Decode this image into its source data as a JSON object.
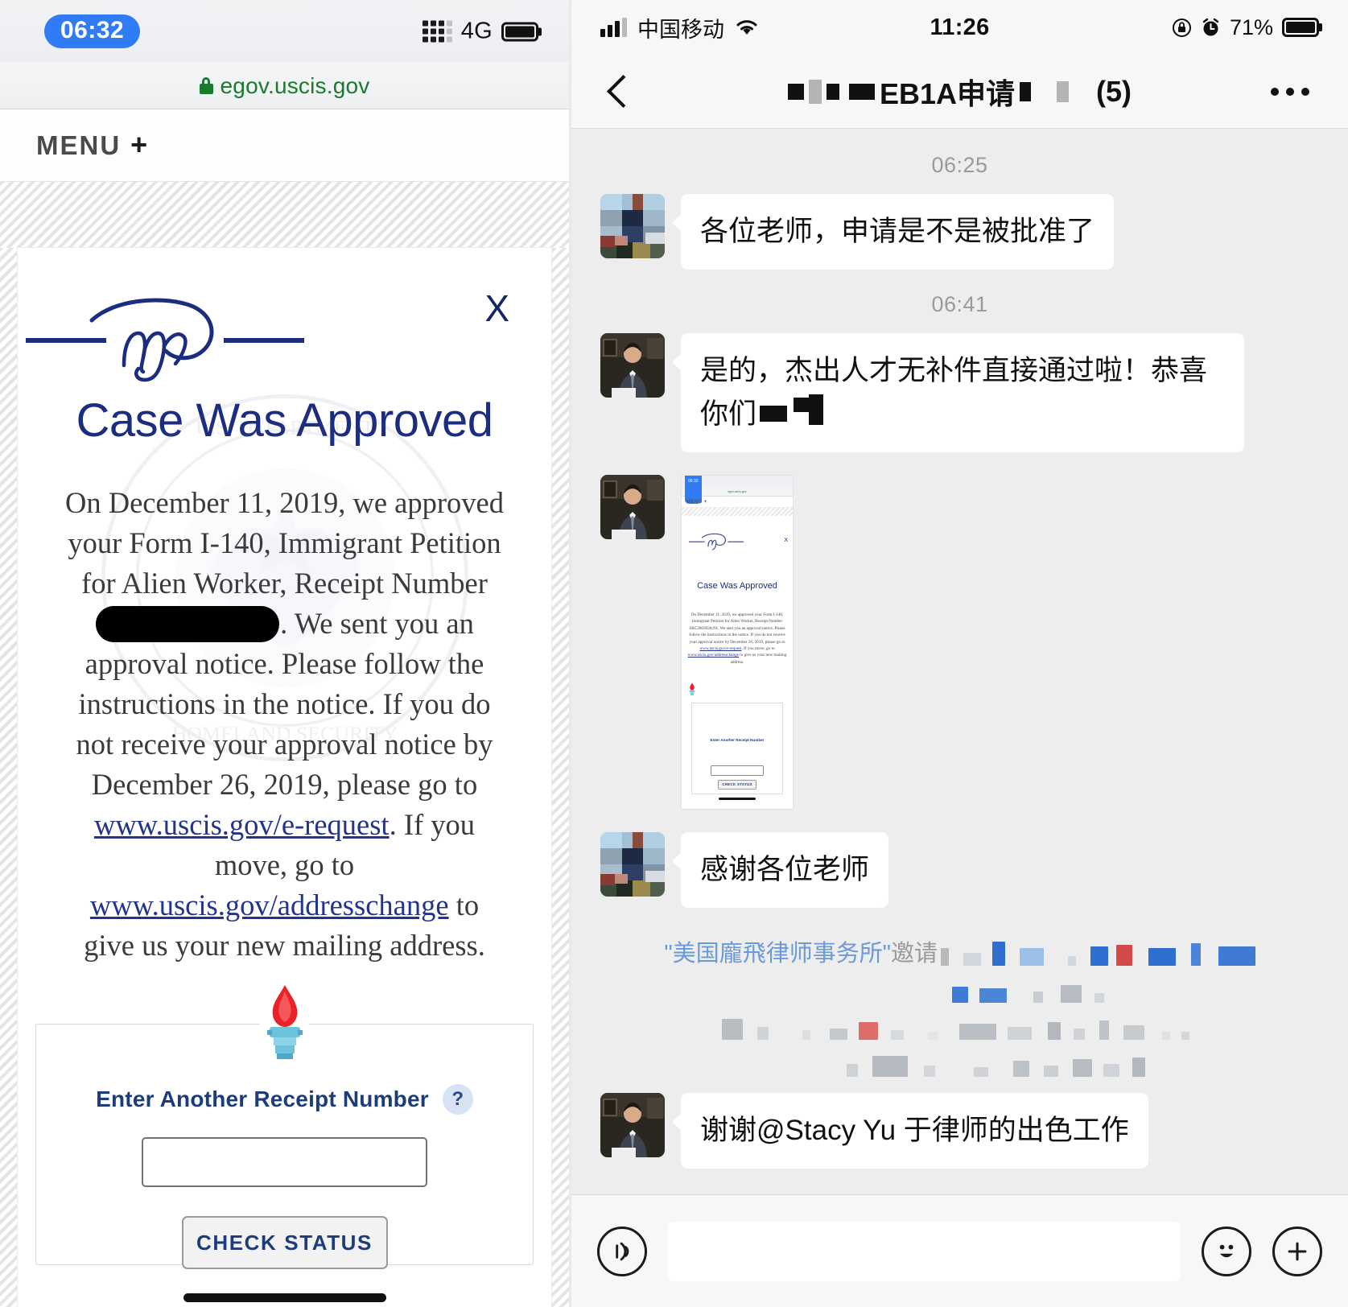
{
  "left": {
    "status": {
      "time": "06:32",
      "network": "4G"
    },
    "browser": {
      "url": "egov.uscis.gov",
      "lock_icon": "lock-icon"
    },
    "menu": {
      "label": "MENU",
      "plus": "+"
    },
    "card": {
      "close_label": "X",
      "logo_alt": "my-uscis-logo",
      "title": "Case Was Approved",
      "body_1": "On December 11, 2019, we approved your Form I-140, Immigrant Petition for Alien Worker, Receipt Number ",
      "body_redacted": "",
      "body_2": ". We sent you an approval notice. Please follow the instructions in the notice. If you do not receive your approval notice by December 26, 2019, please go to ",
      "link_1": "www.uscis.gov/e-request",
      "body_3": ". If you move, go to ",
      "link_2": "www.uscis.gov/addresschange",
      "body_4": " to give us your new mailing address.",
      "torch_icon": "torch-icon",
      "fieldset_label": "Enter Another Receipt Number",
      "help_label": "?",
      "receipt_value": "",
      "receipt_placeholder": "",
      "check_button": "CHECK STATUS"
    }
  },
  "right": {
    "status": {
      "carrier": "中国移动",
      "wifi_icon": "wifi-icon",
      "time": "11:26",
      "rotation_lock_icon": "rotation-lock-icon",
      "alarm_icon": "alarm-icon",
      "battery": "71%"
    },
    "nav": {
      "back_icon": "back-chevron-icon",
      "title_text": "EB1A申请",
      "member_count": "(5)",
      "more_icon": "more-dots-icon"
    },
    "messages": [
      {
        "type": "timestamp",
        "value": "06:25"
      },
      {
        "type": "text",
        "avatar": "pixelated-avatar",
        "text": "各位老师，申请是不是被批准了"
      },
      {
        "type": "timestamp",
        "value": "06:41"
      },
      {
        "type": "text",
        "avatar": "lawyer-photo-avatar",
        "text": "是的，杰出人才无补件直接通过啦！恭喜你们"
      },
      {
        "type": "image",
        "avatar": "lawyer-photo-avatar",
        "thumb": {
          "time": "06:32",
          "url": "egov.uscis.gov",
          "menu": "MENU +",
          "close": "X",
          "title": "Case Was Approved",
          "body_1": "On December 11, 2019, we approved your Form I-140, Immigrant Petition for Alien Worker, Receipt Number SRC2003030291. We sent you an approval notice. Please follow the instructions in the notice. If you do not receive your approval notice by December 26, 2019, please go to ",
          "link_1": "www.uscis.gov/e-request",
          "body_2": ". If you move, go to ",
          "link_2": "www.uscis.gov/addresschange",
          "body_3": " to give us your new mailing address.",
          "field_label": "Enter Another Receipt Number",
          "help": "?",
          "button": "CHECK STATUS"
        }
      },
      {
        "type": "text",
        "avatar": "pixelated-avatar",
        "text": "感谢各位老师"
      },
      {
        "type": "system",
        "quoted_name": "\"美国龐飛律师事务所\"",
        "action": "邀请",
        "redacted": true
      },
      {
        "type": "text",
        "avatar": "lawyer-photo-avatar",
        "text": "谢谢@Stacy Yu 于律师的出色工作"
      }
    ],
    "input_bar": {
      "voice_icon": "voice-input-icon",
      "text_value": "",
      "text_placeholder": "",
      "emoji_icon": "emoji-smiley-icon",
      "plus_icon": "plus-circle-icon"
    }
  },
  "colors": {
    "uscis_blue": "#1c2d80",
    "link_blue": "#23348c",
    "wechat_bg": "#ededed",
    "bubble_white": "#ffffff",
    "ios_blue": "#2f7cf6",
    "lock_green": "#1a7b2e",
    "system_blue": "#6a9bd8"
  }
}
